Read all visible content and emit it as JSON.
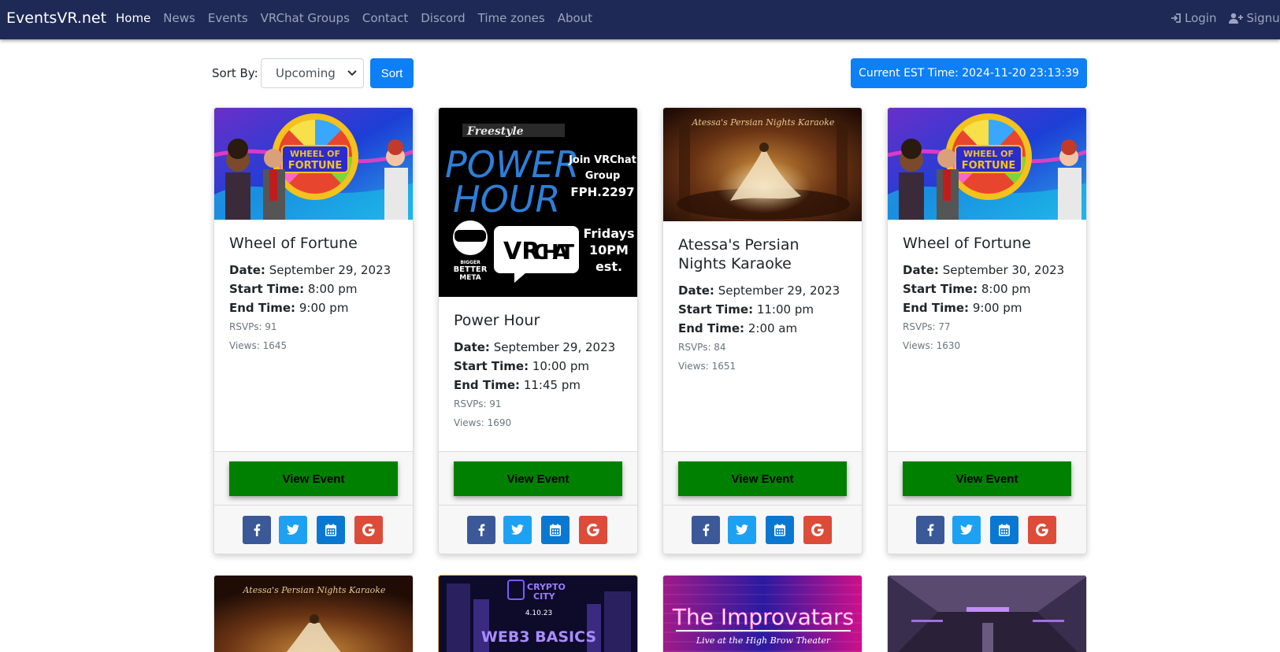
{
  "nav": {
    "brand": "EventsVR.net",
    "links": [
      "Home",
      "News",
      "Events",
      "VRChat Groups",
      "Contact",
      "Discord",
      "Time zones",
      "About"
    ],
    "login": "Login",
    "signup": "Signup"
  },
  "sort": {
    "label": "Sort By:",
    "selected": "Upcoming",
    "button": "Sort"
  },
  "current_time": "Current EST Time: 2024-11-20 23:13:39",
  "labels": {
    "date": "Date:",
    "start": "Start Time:",
    "end": "End Time:",
    "view_event": "View Event"
  },
  "cards": [
    {
      "title": "Wheel of Fortune",
      "date": "September 29, 2023",
      "start": "8:00 pm",
      "end": "9:00 pm",
      "rsvps": "RSVPs: 91",
      "views": "Views: 1645"
    },
    {
      "title": "Power Hour",
      "date": "September 29, 2023",
      "start": "10:00 pm",
      "end": "11:45 pm",
      "rsvps": "RSVPs: 91",
      "views": "Views: 1690",
      "image_text": {
        "brand": "Freestyle",
        "title_1": "POWER",
        "title_2": "HOUR",
        "join_1": "Join VRChat",
        "join_2": "Group",
        "group_id": "FPH.2297",
        "vr": "VR",
        "chat": "CHAT",
        "bigger": "BIGGER",
        "better": "BETTER",
        "meta": "META",
        "day": "Fridays",
        "time": "10PM",
        "tz": "est."
      }
    },
    {
      "title": "Atessa's Persian Nights Karaoke",
      "date": "September 29, 2023",
      "start": "11:00 pm",
      "end": "2:00 am",
      "rsvps": "RSVPs: 84",
      "views": "Views: 1651",
      "image_text": {
        "script": "Atessa's Persian Nights Karaoke"
      }
    },
    {
      "title": "Wheel of Fortune",
      "date": "September 30, 2023",
      "start": "8:00 pm",
      "end": "9:00 pm",
      "rsvps": "RSVPs: 77",
      "views": "Views: 1630"
    }
  ],
  "wof_image": {
    "line1": "WHEEL OF",
    "line2": "FORTUNE"
  },
  "second_row": {
    "karaoke_script": "Atessa's Persian Nights Karaoke",
    "crypto_1": "CRYPTO",
    "crypto_2": "CITY",
    "crypto_date": "4.10.23",
    "web3": "WEB3 BASICS",
    "improv_title": "The Improvatars",
    "improv_sub": "Live at the High Brow Theater"
  },
  "colors": {
    "navbar": "#1e2a55",
    "primary": "#0d7ff7",
    "view_event": "#008000",
    "facebook": "#3b5998",
    "twitter": "#1da1f2",
    "calendar": "#0a78d1",
    "google": "#dd4b39"
  }
}
